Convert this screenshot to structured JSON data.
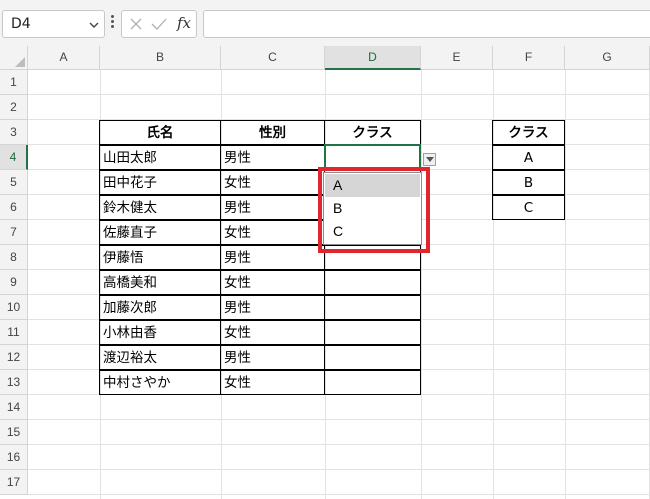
{
  "formula_bar": {
    "name_box": "D4",
    "fx_label": "fx",
    "formula": ""
  },
  "columns": [
    "A",
    "B",
    "C",
    "D",
    "E",
    "F",
    "G"
  ],
  "rows": [
    "1",
    "2",
    "3",
    "4",
    "5",
    "6",
    "7",
    "8",
    "9",
    "10",
    "11",
    "12",
    "13",
    "14",
    "15",
    "16",
    "17"
  ],
  "main_table": {
    "headers": [
      "氏名",
      "性別",
      "クラス"
    ],
    "rows": [
      [
        "山田太郎",
        "男性",
        ""
      ],
      [
        "田中花子",
        "女性",
        ""
      ],
      [
        "鈴木健太",
        "男性",
        ""
      ],
      [
        "佐藤直子",
        "女性",
        ""
      ],
      [
        "伊藤悟",
        "男性",
        ""
      ],
      [
        "高橋美和",
        "女性",
        ""
      ],
      [
        "加藤次郎",
        "男性",
        ""
      ],
      [
        "小林由香",
        "女性",
        ""
      ],
      [
        "渡辺裕太",
        "男性",
        ""
      ],
      [
        "中村さやか",
        "女性",
        ""
      ]
    ]
  },
  "class_list": {
    "header": "クラス",
    "items": [
      "A",
      "B",
      "C"
    ]
  },
  "dropdown": {
    "options": [
      "A",
      "B",
      "C"
    ],
    "selected_index": 0
  },
  "colors": {
    "selection_green": "#217346",
    "highlight_red": "#e0262f"
  }
}
